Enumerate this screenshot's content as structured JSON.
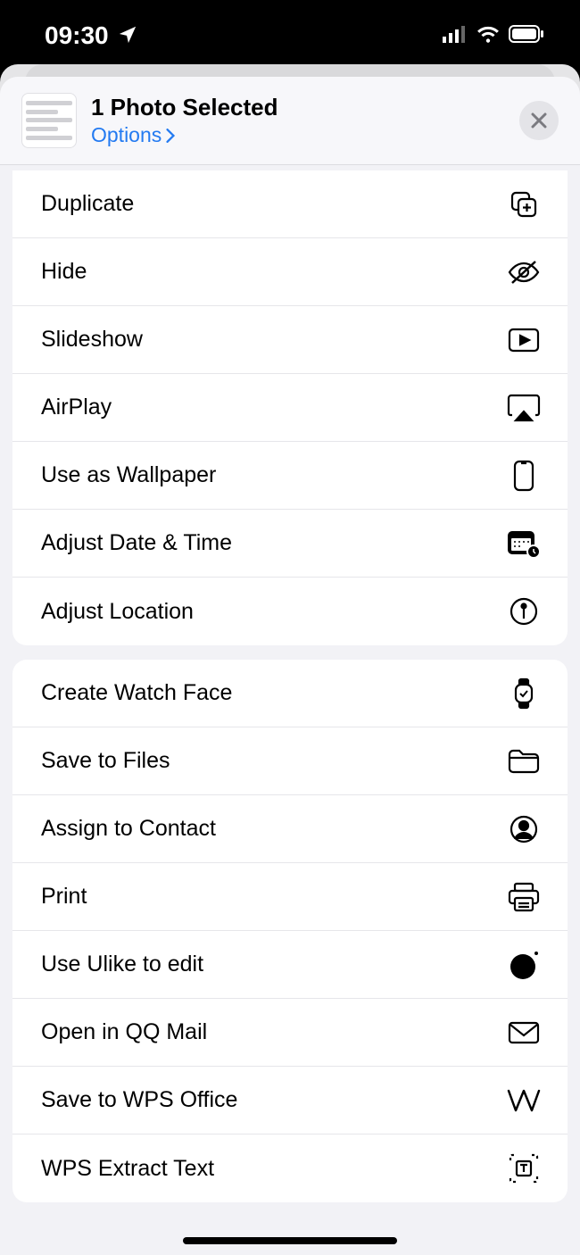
{
  "status": {
    "time": "09:30"
  },
  "header": {
    "title": "1 Photo Selected",
    "options": "Options"
  },
  "group1": {
    "duplicate": "Duplicate",
    "hide": "Hide",
    "slideshow": "Slideshow",
    "airplay": "AirPlay",
    "wallpaper": "Use as Wallpaper",
    "adjust_date": "Adjust Date & Time",
    "adjust_location": "Adjust Location"
  },
  "group2": {
    "watch_face": "Create Watch Face",
    "save_files": "Save to Files",
    "assign_contact": "Assign to Contact",
    "print": "Print",
    "ulike": "Use Ulike to edit",
    "qqmail": "Open in QQ Mail",
    "wps": "Save to WPS Office",
    "wps_extract": "WPS Extract Text"
  }
}
